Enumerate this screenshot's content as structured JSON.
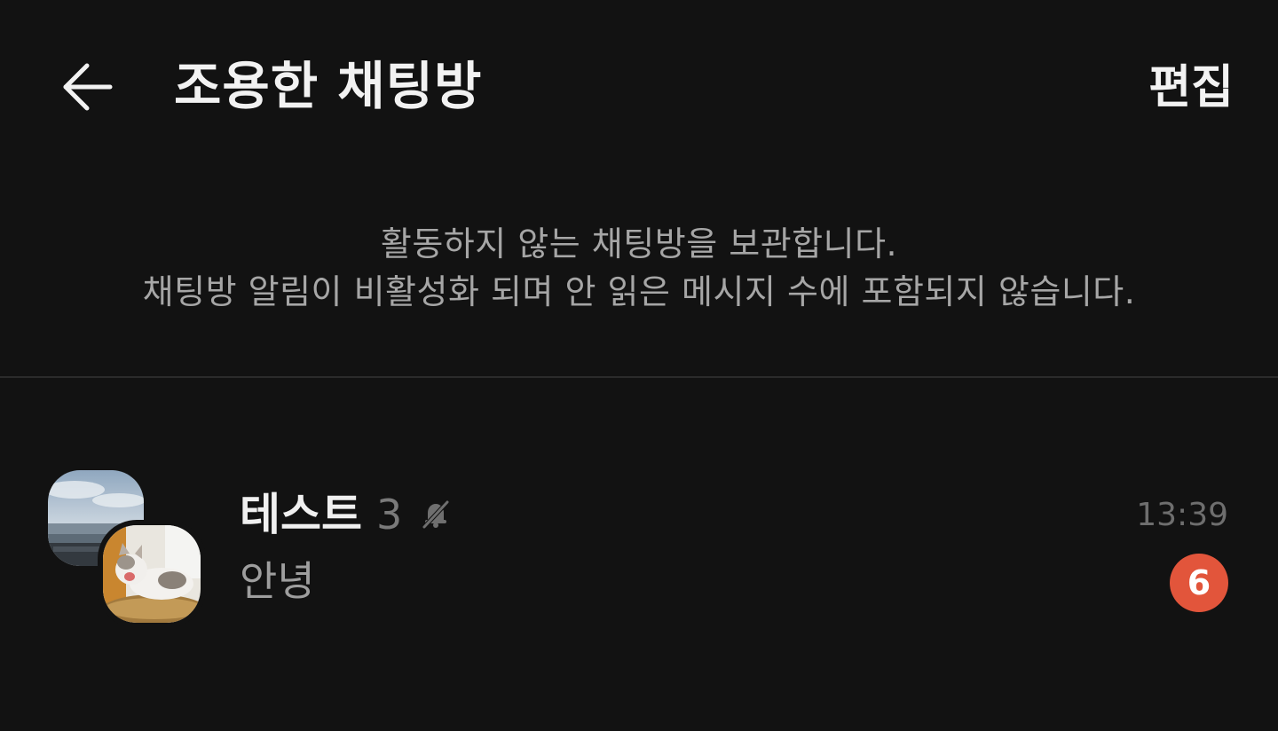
{
  "header": {
    "title": "조용한 채팅방",
    "back_icon": "arrow-left-icon",
    "edit_label": "편집"
  },
  "info": {
    "line1": "활동하지 않는 채팅방을 보관합니다.",
    "line2": "채팅방 알림이 비활성화 되며 안 읽은 메시지 수에 포함되지 않습니다."
  },
  "chats": [
    {
      "name": "테스트",
      "member_count": "3",
      "muted_icon": "bell-off-icon",
      "last_message": "안녕",
      "time": "13:39",
      "unread_count": "6",
      "avatar_icons": [
        "seaside-photo",
        "cat-photo"
      ]
    }
  ],
  "colors": {
    "background": "#121212",
    "badge": "#e2553b",
    "divider": "#2b2b2b",
    "secondary_text": "#a6a6a6"
  }
}
